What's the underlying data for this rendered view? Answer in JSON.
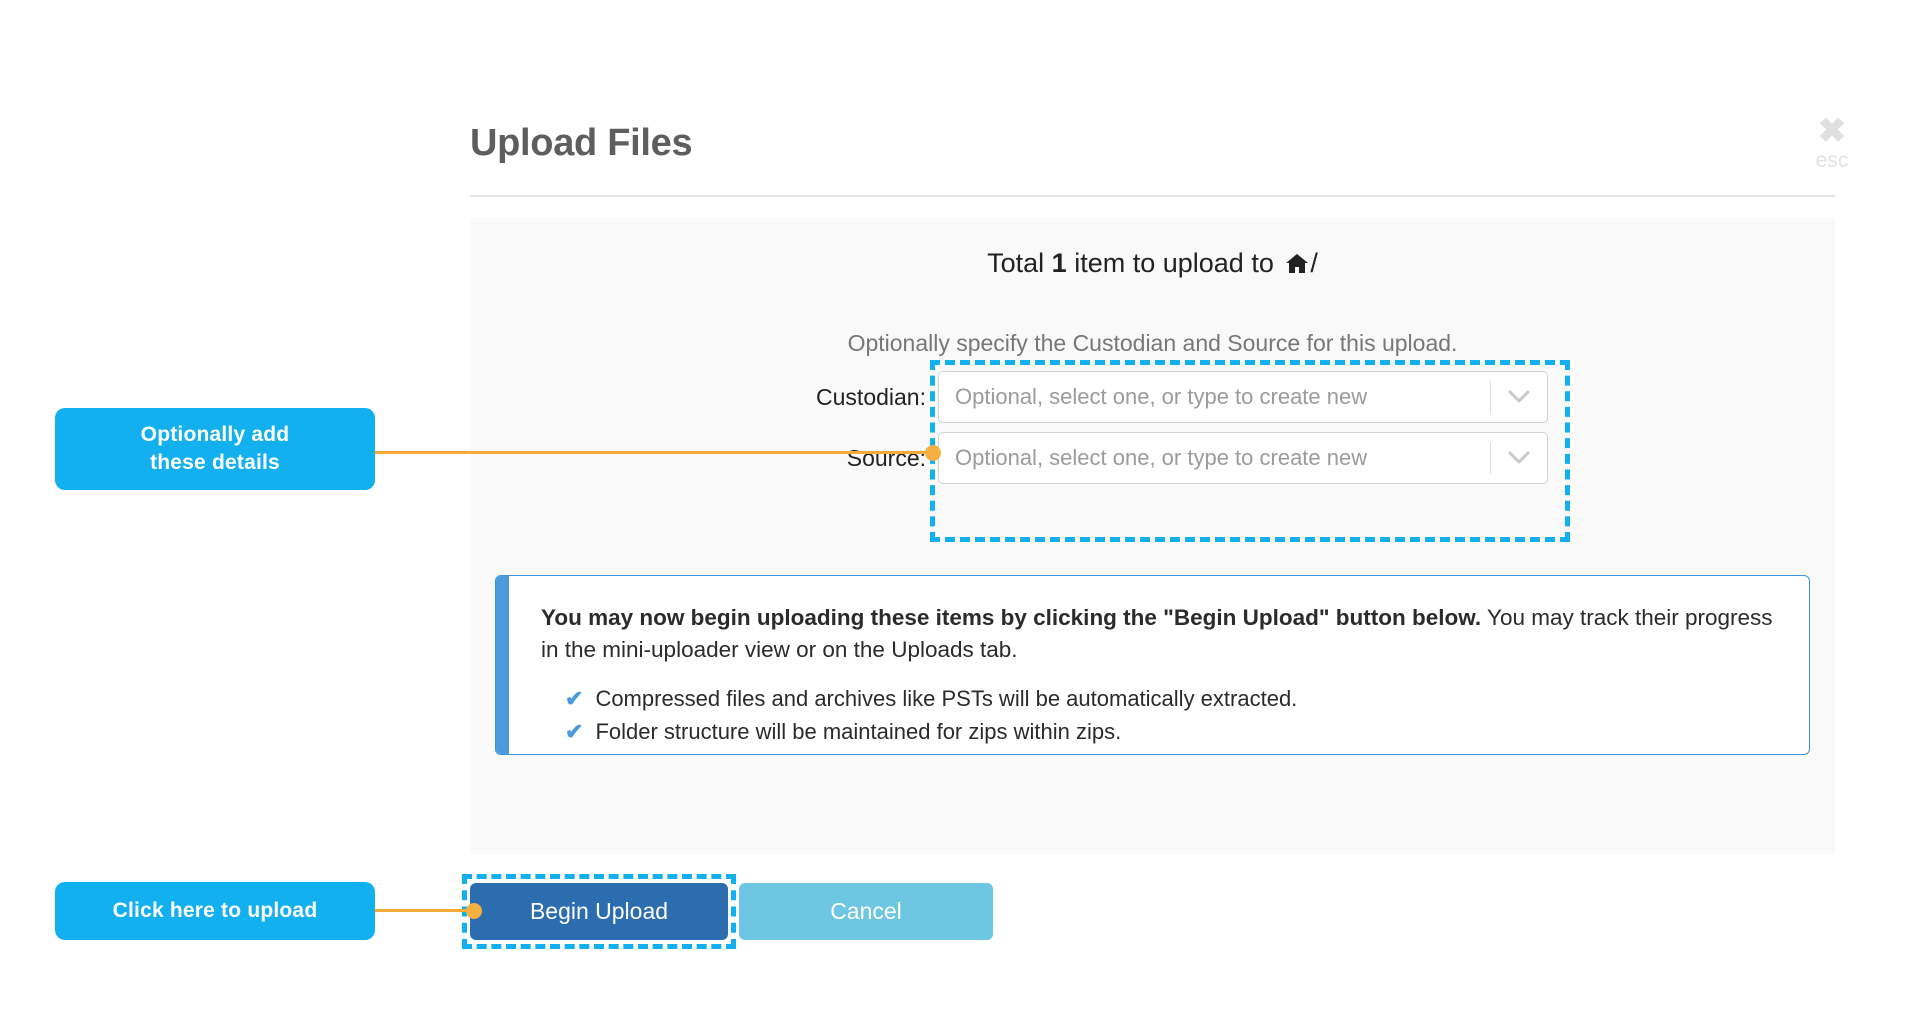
{
  "modal": {
    "title": "Upload Files",
    "close_icon": "close-x-icon",
    "close_label": "esc"
  },
  "summary": {
    "prefix": "Total ",
    "count": "1",
    "suffix": " item to upload to ",
    "destination_icon": "home-icon",
    "destination_path": "/",
    "instruction": "Optionally specify the Custodian and Source for this upload."
  },
  "fields": [
    {
      "label": "Custodian:",
      "value": "",
      "placeholder": "Optional, select one, or type to create new",
      "caret_icon": "chevron-down-icon"
    },
    {
      "label": "Source:",
      "value": "",
      "placeholder": "Optional, select one, or type to create new",
      "caret_icon": "chevron-down-icon"
    }
  ],
  "info_box": {
    "bold_text": "You may now begin uploading these items by clicking the \"Begin Upload\" button below.",
    "rest_text": " You may track their progress in the mini-uploader view or on the Uploads tab.",
    "bullets": [
      {
        "icon": "check-icon",
        "text": "Compressed files and archives like PSTs will be automatically extracted."
      },
      {
        "icon": "check-icon",
        "text": "Folder structure will be maintained for zips within zips."
      }
    ]
  },
  "footer": {
    "begin_label": "Begin Upload",
    "cancel_label": "Cancel"
  },
  "annotations": {
    "details_callout": "Optionally add\nthese details",
    "details_callout_line1": "Optionally add",
    "details_callout_line2": "these details",
    "upload_callout": "Click here to upload"
  },
  "colors": {
    "annotation_blue": "#12b0ef",
    "connector_orange": "#f5ab35",
    "primary_button": "#2c6db0",
    "cancel_button": "#6dc6e2",
    "info_accent": "#4a9ade",
    "panel_background": "#f9f9f9"
  }
}
